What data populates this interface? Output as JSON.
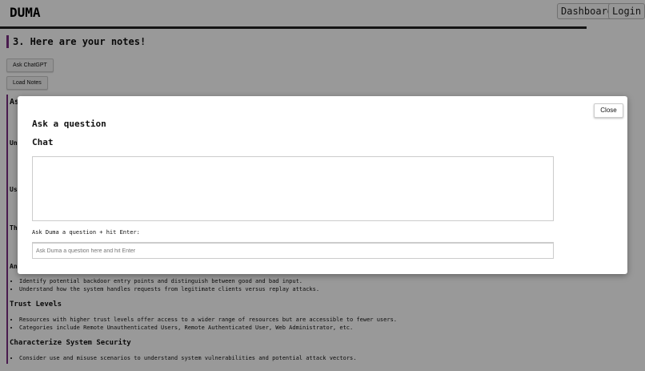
{
  "header": {
    "brand": "DUMA",
    "nav": {
      "dashboard": "Dashboard",
      "login": "Login"
    }
  },
  "page": {
    "section_title": "3. Here are your notes!",
    "ask_chatgpt_label": "Ask ChatGPT",
    "load_notes_label": "Load Notes",
    "notes_title_fragment": "As",
    "cut_labels": [
      "Un",
      "Us",
      "Th",
      "An"
    ],
    "notes": [
      {
        "heading": "",
        "bullets": [
          "Identify potential backdoor entry points and distinguish between good and bad input.",
          "Understand how the system handles requests from legitimate clients versus replay attacks."
        ]
      },
      {
        "heading": "Trust Levels",
        "bullets": [
          "Resources with higher trust levels offer access to a wider range of resources but are accessible to fewer users.",
          "Categories include Remote Unauthenticated Users, Remote Authenticated User, Web Administrator, etc."
        ]
      },
      {
        "heading": "Characterize System Security",
        "bullets": [
          "Consider use and misuse scenarios to understand system vulnerabilities and potential attack vectors."
        ]
      }
    ]
  },
  "modal": {
    "close_label": "Close",
    "title": "Ask a question",
    "chat_heading": "Chat",
    "prompt_label": "Ask Duma a question + hit Enter:",
    "input_placeholder": "Ask Duma a question here and hit Enter",
    "input_value": ""
  }
}
